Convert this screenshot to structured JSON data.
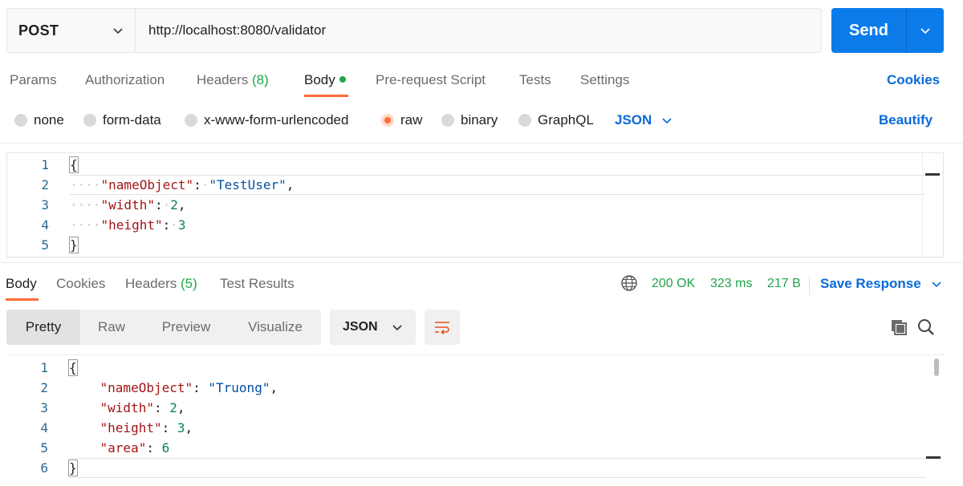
{
  "request": {
    "method": "POST",
    "url": "http://localhost:8080/validator",
    "send_label": "Send"
  },
  "request_tabs": {
    "params": "Params",
    "authorization": "Authorization",
    "headers": "Headers",
    "headers_count": "(8)",
    "body": "Body",
    "prerequest": "Pre-request Script",
    "tests": "Tests",
    "settings": "Settings",
    "cookies_link": "Cookies"
  },
  "body_types": {
    "none": "none",
    "form_data": "form-data",
    "urlencoded": "x-www-form-urlencoded",
    "raw": "raw",
    "binary": "binary",
    "graphql": "GraphQL",
    "selected": "raw",
    "language": "JSON",
    "beautify": "Beautify"
  },
  "request_body": {
    "line_numbers": [
      "1",
      "2",
      "3",
      "4",
      "5"
    ],
    "open_brace": "{",
    "close_brace": "}",
    "fields": [
      {
        "key": "\"nameObject\"",
        "value": "\"TestUser\"",
        "type": "string",
        "trail": ","
      },
      {
        "key": "\"width\"",
        "value": "2",
        "type": "number",
        "trail": ","
      },
      {
        "key": "\"height\"",
        "value": "3",
        "type": "number",
        "trail": ""
      }
    ]
  },
  "response_tabs": {
    "body": "Body",
    "cookies": "Cookies",
    "headers": "Headers",
    "headers_count": "(5)",
    "test_results": "Test Results",
    "status": "200 OK",
    "time": "323 ms",
    "size": "217 B",
    "save_response": "Save Response"
  },
  "view_modes": {
    "pretty": "Pretty",
    "raw": "Raw",
    "preview": "Preview",
    "visualize": "Visualize",
    "format": "JSON"
  },
  "response_body": {
    "line_numbers": [
      "1",
      "2",
      "3",
      "4",
      "5",
      "6"
    ],
    "open_brace": "{",
    "close_brace": "}",
    "fields": [
      {
        "key": "\"nameObject\"",
        "value": "\"Truong\"",
        "type": "string",
        "trail": ","
      },
      {
        "key": "\"width\"",
        "value": "2",
        "type": "number",
        "trail": ","
      },
      {
        "key": "\"height\"",
        "value": "3",
        "type": "number",
        "trail": ","
      },
      {
        "key": "\"area\"",
        "value": "6",
        "type": "number",
        "trail": ""
      }
    ]
  },
  "colors": {
    "accent_orange": "#ff6c37",
    "send_blue": "#0c7bea",
    "link_blue": "#0a6ad8",
    "status_green": "#20a34a",
    "json_key": "#a31515",
    "json_string": "#0451a5",
    "json_number": "#098658"
  },
  "icons": {
    "method_dropdown": "chevron-down-icon",
    "send_dropdown": "chevron-down-icon",
    "network": "globe-icon",
    "wrap": "wrap-lines-icon",
    "copy": "copy-icon",
    "search": "search-icon"
  }
}
